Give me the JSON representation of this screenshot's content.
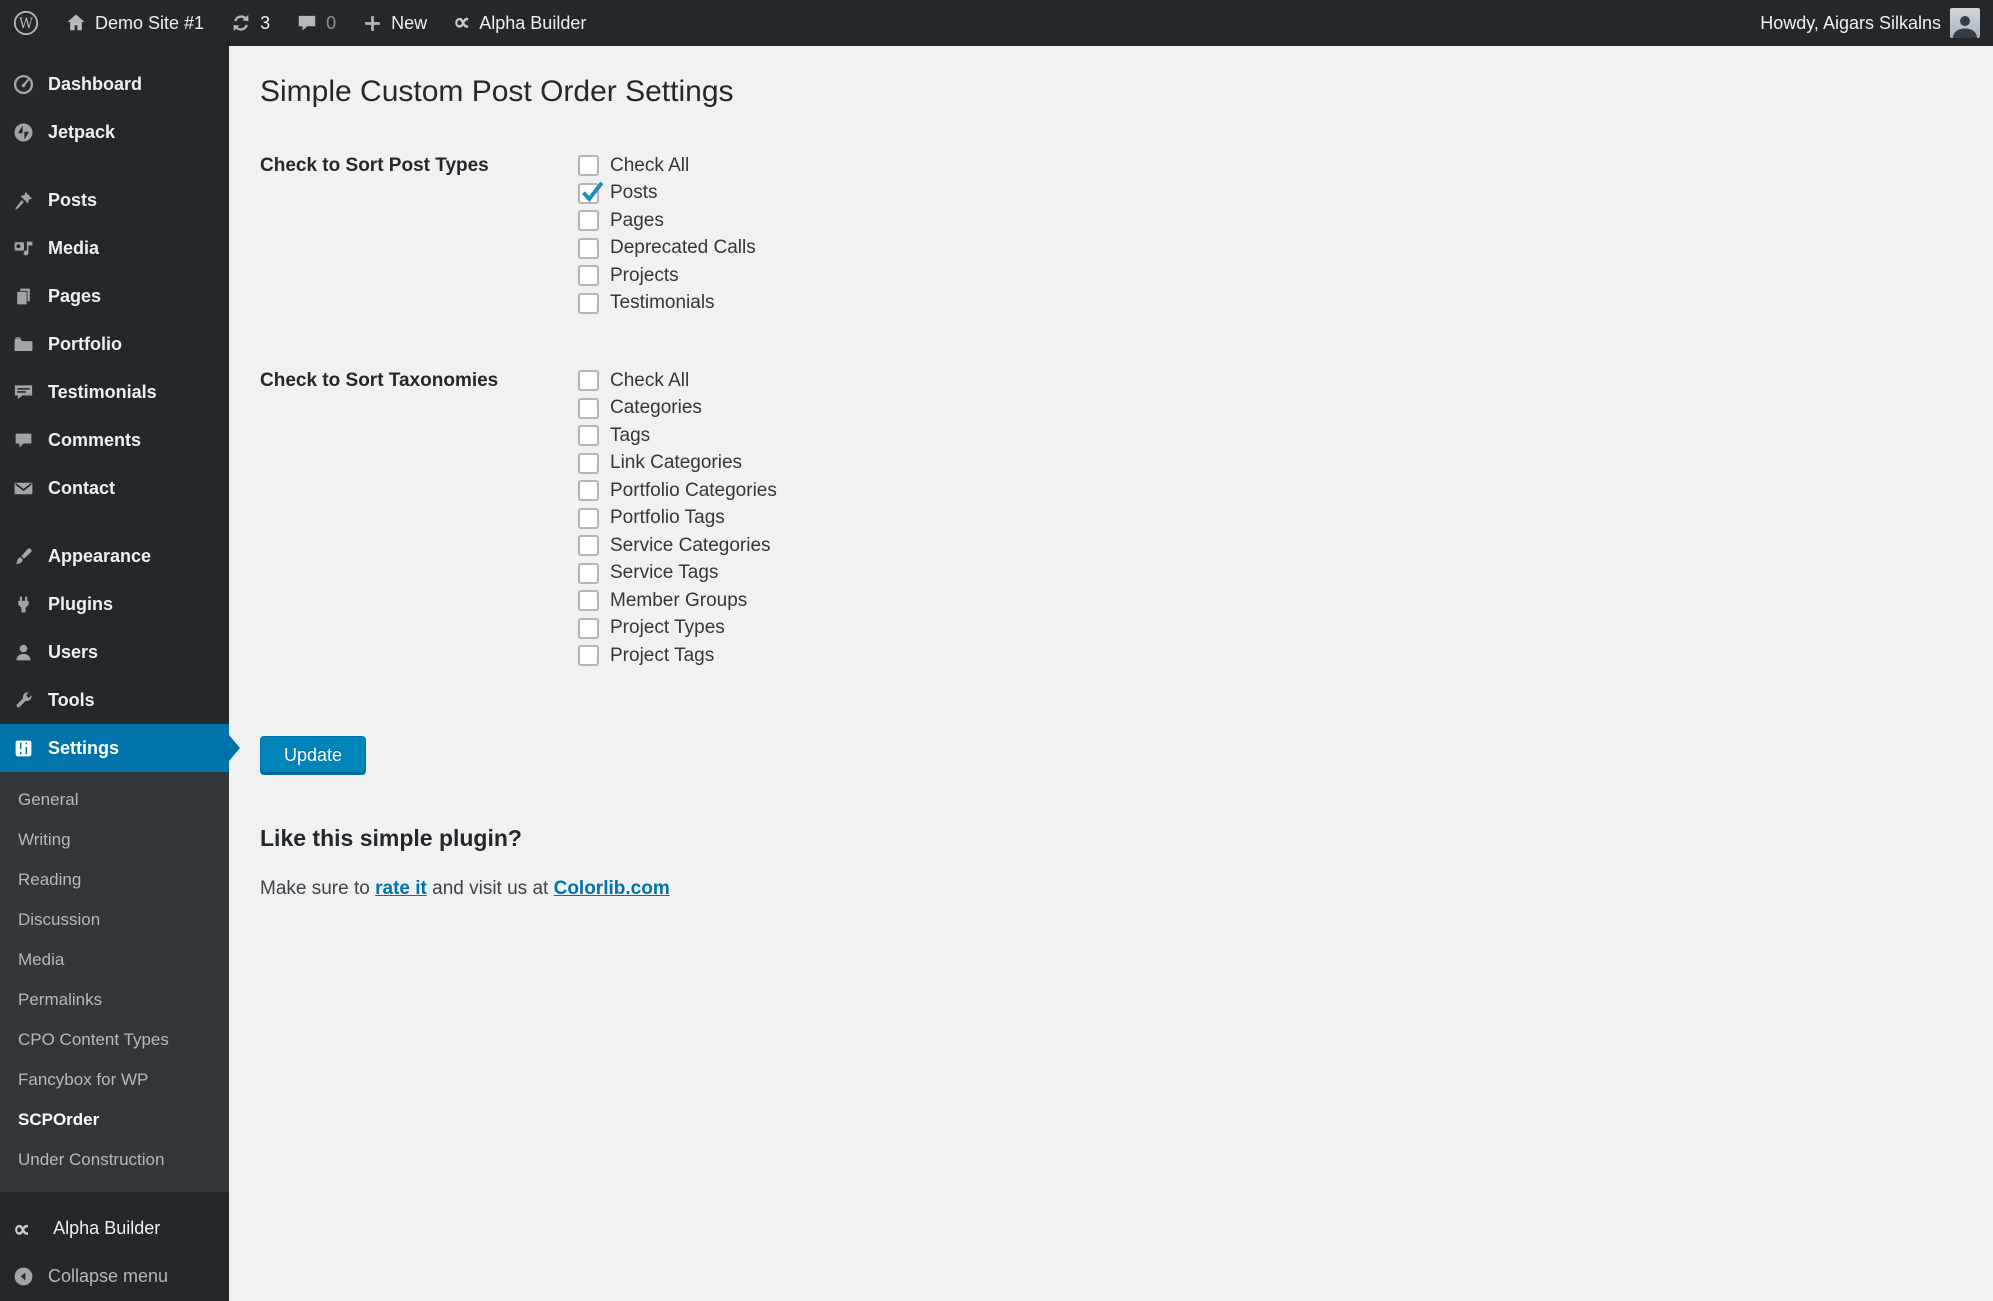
{
  "topbar": {
    "site_name": "Demo Site #1",
    "update_count": "3",
    "comment_count": "0",
    "new_label": "New",
    "builder_label": "Alpha Builder",
    "howdy": "Howdy, Aigars Silkalns"
  },
  "sidebar": {
    "items": [
      {
        "label": "Dashboard",
        "icon": "dashboard-icon"
      },
      {
        "label": "Jetpack",
        "icon": "jetpack-icon"
      },
      {
        "label": "Posts",
        "icon": "pushpin-icon"
      },
      {
        "label": "Media",
        "icon": "media-icon"
      },
      {
        "label": "Pages",
        "icon": "pages-icon"
      },
      {
        "label": "Portfolio",
        "icon": "portfolio-icon"
      },
      {
        "label": "Testimonials",
        "icon": "testimonials-icon"
      },
      {
        "label": "Comments",
        "icon": "comments-icon"
      },
      {
        "label": "Contact",
        "icon": "contact-icon"
      },
      {
        "label": "Appearance",
        "icon": "appearance-icon"
      },
      {
        "label": "Plugins",
        "icon": "plugins-icon"
      },
      {
        "label": "Users",
        "icon": "users-icon"
      },
      {
        "label": "Tools",
        "icon": "tools-icon"
      },
      {
        "label": "Settings",
        "icon": "settings-icon",
        "active": true
      }
    ],
    "settings_submenu": [
      "General",
      "Writing",
      "Reading",
      "Discussion",
      "Media",
      "Permalinks",
      "CPO Content Types",
      "Fancybox for WP",
      "SCPOrder",
      "Under Construction"
    ],
    "active_submenu": "SCPOrder",
    "builder_label": "Alpha Builder",
    "collapse_label": "Collapse menu"
  },
  "main": {
    "title": "Simple Custom Post Order Settings",
    "post_types": {
      "label": "Check to Sort Post Types",
      "options": [
        {
          "label": "Check All",
          "checked": false
        },
        {
          "label": "Posts",
          "checked": true
        },
        {
          "label": "Pages",
          "checked": false
        },
        {
          "label": "Deprecated Calls",
          "checked": false
        },
        {
          "label": "Projects",
          "checked": false
        },
        {
          "label": "Testimonials",
          "checked": false
        }
      ]
    },
    "taxonomies": {
      "label": "Check to Sort Taxonomies",
      "options": [
        {
          "label": "Check All",
          "checked": false
        },
        {
          "label": "Categories",
          "checked": false
        },
        {
          "label": "Tags",
          "checked": false
        },
        {
          "label": "Link Categories",
          "checked": false
        },
        {
          "label": "Portfolio Categories",
          "checked": false
        },
        {
          "label": "Portfolio Tags",
          "checked": false
        },
        {
          "label": "Service Categories",
          "checked": false
        },
        {
          "label": "Service Tags",
          "checked": false
        },
        {
          "label": "Member Groups",
          "checked": false
        },
        {
          "label": "Project Types",
          "checked": false
        },
        {
          "label": "Project Tags",
          "checked": false
        }
      ]
    },
    "update_button": "Update",
    "promo": {
      "heading": "Like this simple plugin?",
      "text_before": "Make sure to ",
      "rate_link": "rate it",
      "text_middle": " and visit us at ",
      "site_link": "Colorlib.com"
    }
  },
  "colors": {
    "admin_bar_bg": "#23282d",
    "submenu_bg": "#32373c",
    "accent_blue": "#0073aa",
    "button_bg": "#0085ba",
    "link_blue": "#0073aa",
    "check_blue": "#1e8cbe",
    "content_bg": "#f1f1f1",
    "submenu_text": "#b4b9be"
  }
}
